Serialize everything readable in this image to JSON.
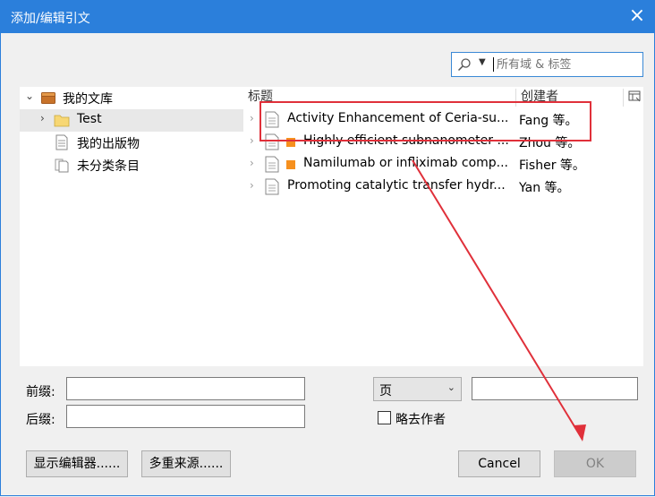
{
  "window": {
    "title": "添加/编辑引文",
    "close_icon": "×"
  },
  "search": {
    "placeholder": "所有域 & 标签"
  },
  "tree": {
    "items": [
      {
        "label": "我的文库",
        "icon": "library-icon"
      },
      {
        "label": "Test",
        "icon": "folder-icon",
        "selected": true
      },
      {
        "label": "我的出版物",
        "icon": "document-icon"
      },
      {
        "label": "未分类条目",
        "icon": "documents-stack-icon"
      }
    ]
  },
  "list": {
    "columns": {
      "title": "标题",
      "creator": "创建者"
    },
    "rows": [
      {
        "title": "Activity Enhancement of Ceria-su...",
        "creator": "Fang 等。",
        "tag": false
      },
      {
        "title": "Highly efficient subnanometer ...",
        "creator": "Zhou 等。",
        "tag": true
      },
      {
        "title": "Namilumab or infliximab comp...",
        "creator": "Fisher 等。",
        "tag": true
      },
      {
        "title": "Promoting catalytic transfer hydr...",
        "creator": "Yan 等。",
        "tag": false
      }
    ]
  },
  "form": {
    "prefix_label": "前缀:",
    "suffix_label": "后缀:",
    "prefix_value": "",
    "suffix_value": "",
    "locator_type": "页",
    "locator_value": "",
    "omit_author_label": "略去作者",
    "omit_author_checked": false
  },
  "buttons": {
    "show_editor": "显示编辑器......",
    "multiple_sources": "多重来源......",
    "cancel": "Cancel",
    "ok": "OK"
  },
  "colors": {
    "titlebar": "#2b7fdb",
    "tag": "#f6901e",
    "annotation": "#e0303a"
  }
}
